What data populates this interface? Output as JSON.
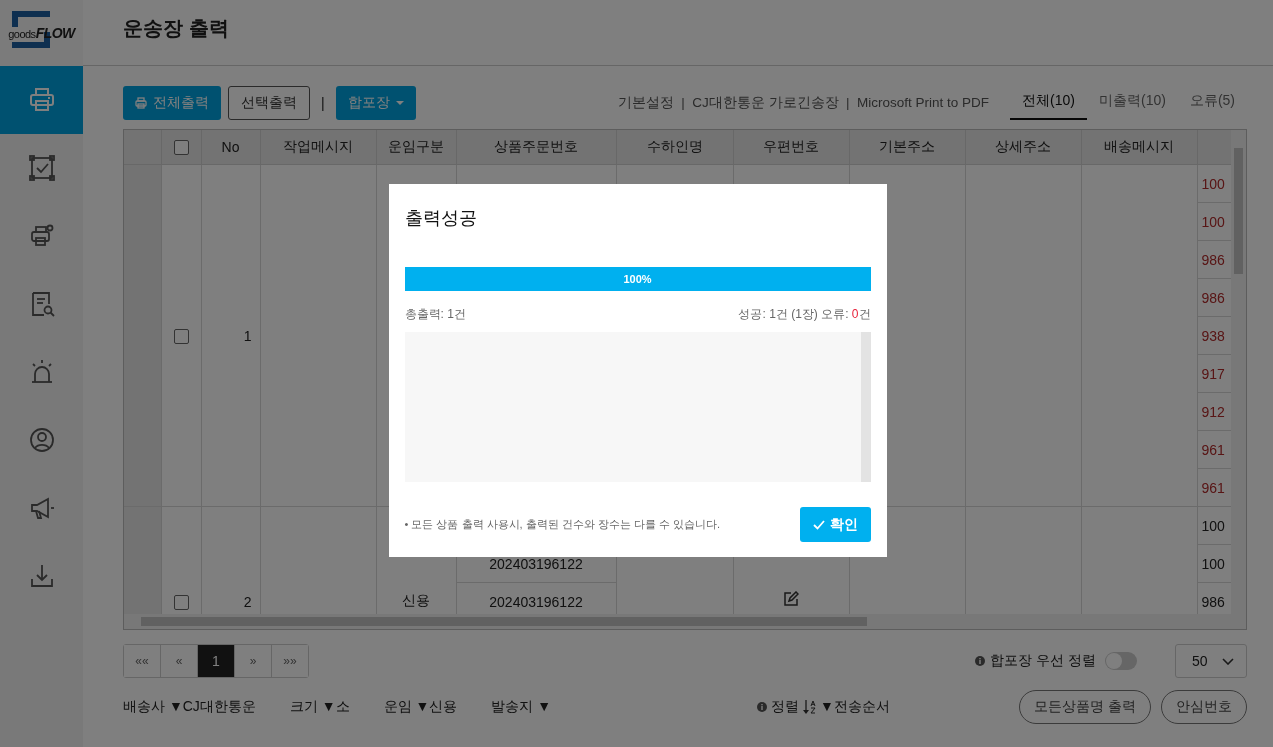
{
  "logo": {
    "text": "goods**FLOW**"
  },
  "sidebar": {
    "items": [
      {
        "selected": true
      },
      {
        "selected": false
      },
      {
        "selected": false
      },
      {
        "selected": false
      },
      {
        "selected": false
      },
      {
        "selected": false
      },
      {
        "selected": false
      },
      {
        "selected": false
      }
    ]
  },
  "header": {
    "title": "운송장 출력"
  },
  "toolbar": {
    "buttons": [
      {
        "label": "전체출력",
        "kind": "primary"
      },
      {
        "label": "선택출력",
        "kind": "outline"
      },
      {
        "label": "|",
        "kind": "separator"
      },
      {
        "label": "합포장",
        "kind": "dropdown"
      }
    ],
    "info": "기본설정  |  CJ대한통운 가로긴송장  |  Microsoft Print to PDF"
  },
  "tabs": [
    {
      "label": "전체(10)",
      "selected": true
    },
    {
      "label": "미출력(10)",
      "selected": false
    },
    {
      "label": "오류(5)",
      "selected": false
    }
  ],
  "table": {
    "header_checkbox": {
      "checked": false
    },
    "columns": [
      "No",
      "작업메시지",
      "운임구분",
      "상품주문번호",
      "수하인명",
      "우편번호",
      "기본주소",
      "상세주소",
      "배송메시지"
    ],
    "rows": [
      {
        "checked": false,
        "no": "1",
        "error": true,
        "editable": false,
        "items": [
          {
            "column_10": "100"
          },
          {
            "column_10": "100"
          },
          {
            "column_10": "986"
          },
          {
            "column_10": "986"
          },
          {
            "column_10": "938"
          },
          {
            "column_10": "917"
          },
          {
            "column_10": "912"
          },
          {
            "column_10": "961"
          },
          {
            "column_10": "961"
          }
        ]
      },
      {
        "checked": false,
        "no": "2",
        "fare": "신용",
        "error": false,
        "editable": true,
        "items": [
          {
            "column_10": "100"
          },
          {
            "order_number": "202403196122",
            "column_10": "100"
          },
          {
            "order_number": "202403196122",
            "column_10": "986"
          }
        ]
      }
    ]
  },
  "pagination": [
    {
      "label": "««",
      "selected": false
    },
    {
      "label": "«",
      "selected": false
    },
    {
      "label": "1",
      "selected": true
    },
    {
      "label": "»",
      "selected": false
    },
    {
      "label": "»»",
      "selected": false
    }
  ],
  "merge_sort": {
    "label": "합포장 우선 정렬",
    "on": false
  },
  "page_size": "50",
  "filters": [
    {
      "label": "배송사",
      "value": "▼CJ대한통운"
    },
    {
      "label": "크기",
      "value": "▼소"
    },
    {
      "label": "운임",
      "value": "▼신용"
    },
    {
      "label": "발송지",
      "value": "▼"
    }
  ],
  "sort": {
    "label": "정렬",
    "value": "▼전송순서"
  },
  "footer_buttons": [
    "모든상품명 출력",
    "안심번호"
  ],
  "dialog": {
    "title": "출력성공",
    "progress": {
      "level": 1,
      "label": "100%"
    },
    "total": "총출력: 1건",
    "result": "성공: 1건 (1장) 오류: **0**건",
    "note": "• 모든 상품 출력 사용시, 출력된 건수와 장수는 다를 수 있습니다.",
    "ok_button": "확인"
  }
}
